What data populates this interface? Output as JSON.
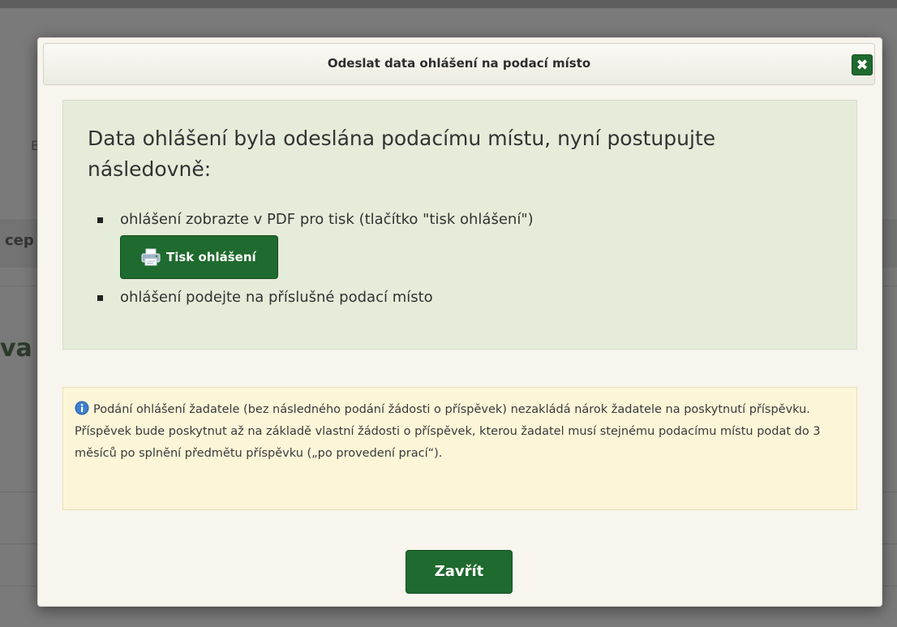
{
  "background": {
    "fragments": [
      "cep",
      "va",
      "E"
    ]
  },
  "dialog": {
    "title": "Odeslat data ohlášení na podací místo",
    "close_icon": "close-icon",
    "success": {
      "heading": "Data ohlášení byla odeslána podacímu místu, nyní postupujte následovně:",
      "steps": [
        "ohlášení zobrazte v PDF pro tisk (tlačítko \"tisk ohlášení\")",
        "ohlášení podejte na příslušné podací místo"
      ],
      "print_button_label": "Tisk ohlášení",
      "print_icon": "printer-icon"
    },
    "info": {
      "icon": "info-icon",
      "text": "Podání ohlášení žadatele (bez následného podání žádosti o příspěvek) nezakládá nárok žadatele na poskytnutí příspěvku. Příspěvek bude poskytnut až na základě vlastní žádosti o příspěvek, kterou žadatel musí stejnému podacímu místu podat do 3 měsíců po splnění předmětu příspěvku („po provedení prací“)."
    },
    "close_button_label": "Zavřít"
  },
  "colors": {
    "accent_green": "#1f6a2e",
    "success_bg": "#e5ecd9",
    "info_bg": "#fcf5d8",
    "overlay": "#7a7a7a"
  }
}
